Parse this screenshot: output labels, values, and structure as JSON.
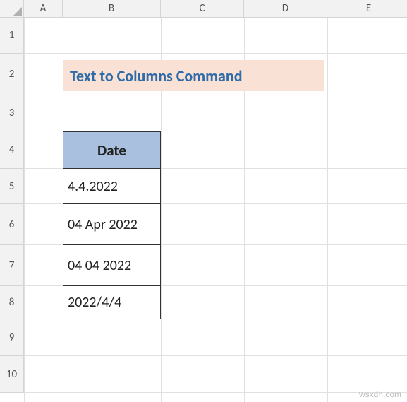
{
  "columns": [
    "A",
    "B",
    "C",
    "D",
    "E"
  ],
  "rows": [
    "1",
    "2",
    "3",
    "4",
    "5",
    "6",
    "7",
    "8",
    "9",
    "10"
  ],
  "title": "Text to Columns Command",
  "table_header": "Date",
  "data": [
    "4.4.2022",
    "04 Apr 2022",
    "04 04 2022",
    "2022/4/4"
  ],
  "watermark": "wsxdn.com",
  "chart_data": {
    "type": "table",
    "title": "Text to Columns Command",
    "categories": [
      "Date"
    ],
    "values": [
      "4.4.2022",
      "04 Apr 2022",
      "04 04 2022",
      "2022/4/4"
    ]
  }
}
